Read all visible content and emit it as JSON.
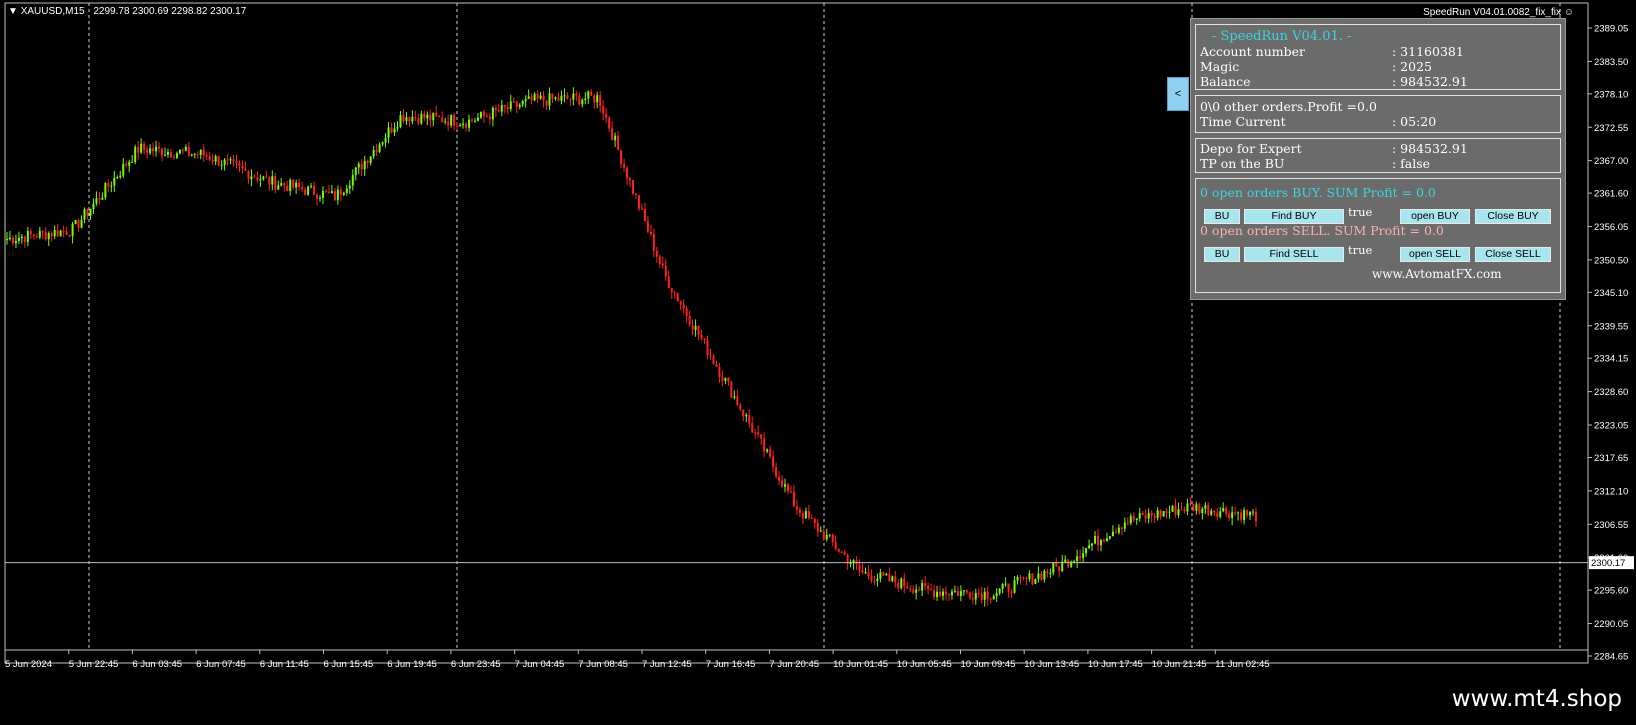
{
  "window": {
    "symbol_label": "XAUUSD,M15",
    "ohlc": "2299.78 2300.69 2298.82 2300.17",
    "ea_label": "SpeedRun V04.01.0082_fix_fix",
    "collapse_label": "<"
  },
  "price_axis": {
    "ticks": [
      "2389.05",
      "2383.50",
      "2378.10",
      "2372.55",
      "2367.00",
      "2361.60",
      "2356.05",
      "2350.50",
      "2345.10",
      "2339.55",
      "2334.15",
      "2328.60",
      "2323.05",
      "2317.65",
      "2312.10",
      "2306.55",
      "2301.00",
      "2295.60",
      "2290.05",
      "2284.65"
    ],
    "current_price": "2300.17"
  },
  "time_axis": {
    "labels": [
      "5 Jun 2024",
      "5 Jun 22:45",
      "6 Jun 03:45",
      "6 Jun 07:45",
      "6 Jun 11:45",
      "6 Jun 15:45",
      "6 Jun 19:45",
      "6 Jun 23:45",
      "7 Jun 04:45",
      "7 Jun 08:45",
      "7 Jun 12:45",
      "7 Jun 16:45",
      "7 Jun 20:45",
      "10 Jun 01:45",
      "10 Jun 05:45",
      "10 Jun 09:45",
      "10 Jun 13:45",
      "10 Jun 17:45",
      "10 Jun 21:45",
      "11 Jun 02:45"
    ]
  },
  "panel": {
    "title": "- SpeedRun V04.01. -",
    "account_number_label": "Account number",
    "account_number_value": ": 31160381",
    "magic_label": "Magic",
    "magic_value": ": 2025",
    "balance_label": "Balance",
    "balance_value": ": 984532.91",
    "other_orders": "0\\0 other orders.Profit =0.0",
    "time_current_label": "Time Current",
    "time_current_value": ": 05:20",
    "depo_label": "Depo for Expert",
    "depo_value": ": 984532.91",
    "tp_bu_label": "TP on the BU",
    "tp_bu_value": ": false",
    "buy_summary": "0 open orders BUY. SUM Profit = 0.0",
    "sell_summary": "0 open orders SELL. SUM Profit = 0.0",
    "bu_label": "BU",
    "find_buy_label": "Find BUY",
    "buy_flag": "true",
    "open_buy_label": "open BUY",
    "close_buy_label": "Close BUY",
    "find_sell_label": "Find SELL",
    "sell_flag": "true",
    "open_sell_label": "open SELL",
    "close_sell_label": "Close SELL",
    "website": "www.AvtomatFX.com"
  },
  "footer": {
    "site": "www.mt4.shop"
  },
  "colors": {
    "bull": "#7CFC00",
    "bear": "#ff2020",
    "panel_bg": "#6b6b6b",
    "accent": "#38d6e3"
  },
  "chart_data": {
    "type": "candlestick",
    "symbol": "XAUUSD",
    "timeframe": "M15",
    "ylim": [
      2284.65,
      2389.05
    ],
    "current_price": 2300.17,
    "x": [
      "5 Jun 2024",
      "5 Jun 22:45",
      "6 Jun 03:45",
      "6 Jun 07:45",
      "6 Jun 11:45",
      "6 Jun 15:45",
      "6 Jun 19:45",
      "6 Jun 23:45",
      "7 Jun 04:45",
      "7 Jun 08:45",
      "7 Jun 12:45",
      "7 Jun 16:45",
      "7 Jun 20:45",
      "10 Jun 01:45",
      "10 Jun 05:45",
      "10 Jun 09:45",
      "10 Jun 13:45",
      "10 Jun 17:45",
      "10 Jun 21:45",
      "11 Jun 02:45"
    ],
    "close": [
      2354.0,
      2355.5,
      2369.0,
      2368.0,
      2363.5,
      2361.0,
      2374.5,
      2373.5,
      2377.0,
      2377.5,
      2348.0,
      2329.0,
      2309.5,
      2298.5,
      2295.5,
      2295.0,
      2299.5,
      2307.0,
      2309.5,
      2308.0
    ],
    "grid": false
  }
}
